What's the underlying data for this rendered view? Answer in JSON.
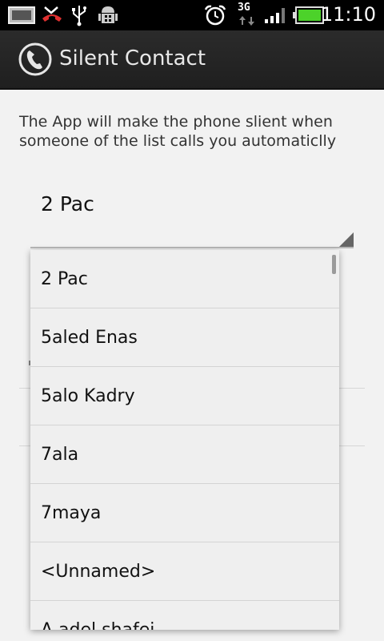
{
  "status_bar": {
    "time": "11:10",
    "network": "3G",
    "icons": [
      "gallery-icon",
      "missed-call-icon",
      "usb-icon",
      "android-debug-icon",
      "alarm-icon",
      "network-3g-icon",
      "signal-icon",
      "battery-icon"
    ],
    "battery_color": "#4cd22a"
  },
  "action_bar": {
    "title": "Silent Contact",
    "icon": "phone-icon"
  },
  "main": {
    "description": "The App will make the phone slient when someone of the list calls you automaticlly",
    "spinner": {
      "selected": "2 Pac"
    }
  },
  "dropdown": {
    "items": [
      "2 Pac",
      "5aled Enas",
      "5alo Kadry",
      "7ala",
      "7maya",
      "<Unnamed>",
      "A adel shafei"
    ]
  }
}
